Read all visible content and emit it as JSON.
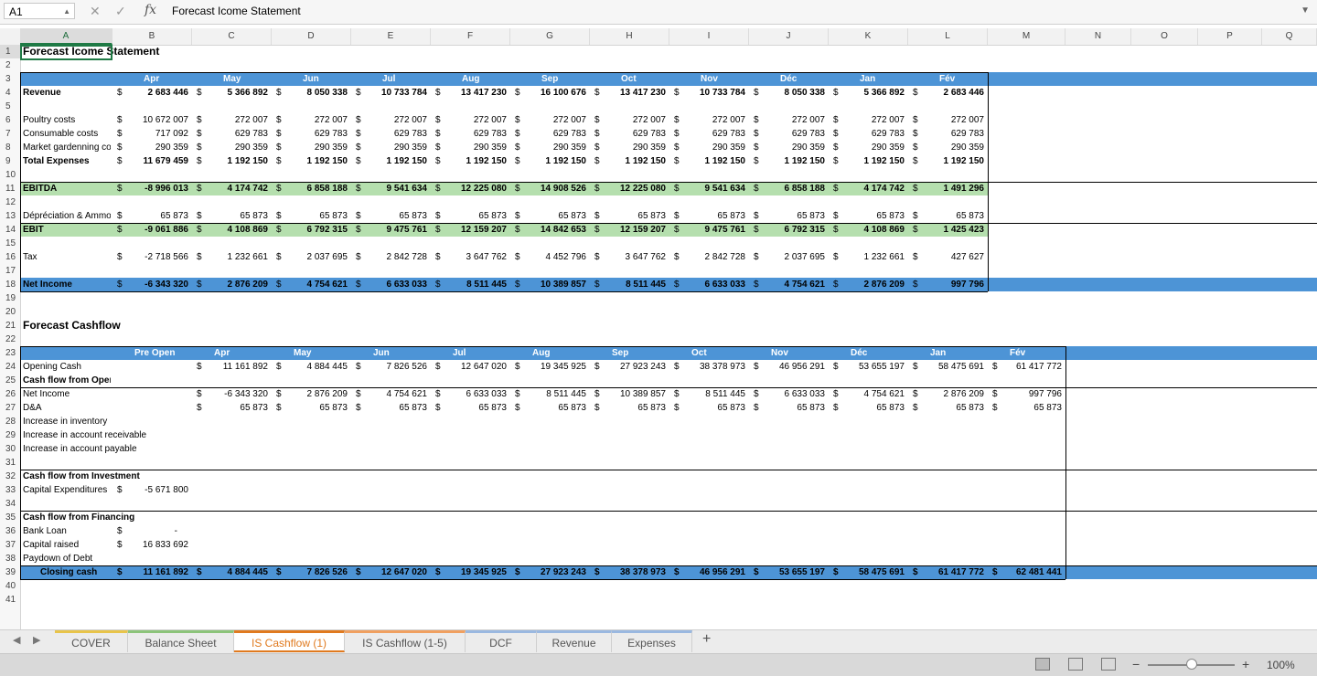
{
  "formula_bar": {
    "cell_ref": "A1",
    "fx": "fx",
    "formula": "Forecast Icome Statement"
  },
  "columns": [
    "A",
    "B",
    "C",
    "D",
    "E",
    "F",
    "G",
    "H",
    "I",
    "J",
    "K",
    "L",
    "M",
    "N",
    "O",
    "P",
    "Q"
  ],
  "rows": [
    "1",
    "2",
    "3",
    "4",
    "5",
    "6",
    "7",
    "8",
    "9",
    "10",
    "11",
    "12",
    "13",
    "14",
    "15",
    "16",
    "17",
    "18",
    "19",
    "20",
    "21",
    "22",
    "23",
    "24",
    "25",
    "26",
    "27",
    "28",
    "29",
    "30",
    "31",
    "32",
    "33",
    "34",
    "35",
    "36",
    "37",
    "38",
    "39",
    "40",
    "41"
  ],
  "income": {
    "title": "Forecast Icome Statement",
    "months": [
      "Apr",
      "May",
      "Jun",
      "Jul",
      "Aug",
      "Sep",
      "Oct",
      "Nov",
      "Déc",
      "Jan",
      "Fév"
    ],
    "rows": [
      {
        "label": "Revenue",
        "bold": true,
        "values": [
          "2 683 446",
          "5 366 892",
          "8 050 338",
          "10 733 784",
          "13 417 230",
          "16 100 676",
          "13 417 230",
          "10 733 784",
          "8 050 338",
          "5 366 892",
          "2 683 446"
        ]
      },
      {
        "label": "Poultry costs",
        "values": [
          "10 672 007",
          "272 007",
          "272 007",
          "272 007",
          "272 007",
          "272 007",
          "272 007",
          "272 007",
          "272 007",
          "272 007",
          "272 007"
        ]
      },
      {
        "label": "Consumable costs",
        "values": [
          "717 092",
          "629 783",
          "629 783",
          "629 783",
          "629 783",
          "629 783",
          "629 783",
          "629 783",
          "629 783",
          "629 783",
          "629 783"
        ]
      },
      {
        "label": "Market gardenning co",
        "values": [
          "290 359",
          "290 359",
          "290 359",
          "290 359",
          "290 359",
          "290 359",
          "290 359",
          "290 359",
          "290 359",
          "290 359",
          "290 359"
        ]
      },
      {
        "label": "Total Expenses",
        "bold": true,
        "values": [
          "11 679 459",
          "1 192 150",
          "1 192 150",
          "1 192 150",
          "1 192 150",
          "1 192 150",
          "1 192 150",
          "1 192 150",
          "1 192 150",
          "1 192 150",
          "1 192 150"
        ]
      },
      {
        "label": "EBITDA",
        "values": [
          "-8 996 013",
          "4 174 742",
          "6 858 188",
          "9 541 634",
          "12 225 080",
          "14 908 526",
          "12 225 080",
          "9 541 634",
          "6 858 188",
          "4 174 742",
          "1 491 296"
        ]
      },
      {
        "label": "Dépréciation & Ammo",
        "values": [
          "65 873",
          "65 873",
          "65 873",
          "65 873",
          "65 873",
          "65 873",
          "65 873",
          "65 873",
          "65 873",
          "65 873",
          "65 873"
        ]
      },
      {
        "label": "EBIT",
        "values": [
          "-9 061 886",
          "4 108 869",
          "6 792 315",
          "9 475 761",
          "12 159 207",
          "14 842 653",
          "12 159 207",
          "9 475 761",
          "6 792 315",
          "4 108 869",
          "1 425 423"
        ]
      },
      {
        "label": "Tax",
        "values": [
          "-2 718 566",
          "1 232 661",
          "2 037 695",
          "2 842 728",
          "3 647 762",
          "4 452 796",
          "3 647 762",
          "2 842 728",
          "2 037 695",
          "1 232 661",
          "427 627"
        ]
      },
      {
        "label": "Net Income",
        "values": [
          "-6 343 320",
          "2 876 209",
          "4 754 621",
          "6 633 033",
          "8 511 445",
          "10 389 857",
          "8 511 445",
          "6 633 033",
          "4 754 621",
          "2 876 209",
          "997 796"
        ]
      }
    ]
  },
  "cashflow": {
    "title": "Forecast Cashflow",
    "months": [
      "Pre Open",
      "Apr",
      "May",
      "Jun",
      "Jul",
      "Aug",
      "Sep",
      "Oct",
      "Nov",
      "Déc",
      "Jan",
      "Fév"
    ],
    "opening": {
      "label": "Opening Cash",
      "values": [
        "11 161 892",
        "4 884 445",
        "7 826 526",
        "12 647 020",
        "19 345 925",
        "27 923 243",
        "38 378 973",
        "46 956 291",
        "53 655 197",
        "58 475 691",
        "61 417 772"
      ]
    },
    "ops_title": "Cash flow from Operations",
    "net_income": {
      "label": "Net Income",
      "values": [
        "-6 343 320",
        "2 876 209",
        "4 754 621",
        "6 633 033",
        "8 511 445",
        "10 389 857",
        "8 511 445",
        "6 633 033",
        "4 754 621",
        "2 876 209",
        "997 796"
      ]
    },
    "da": {
      "label": "D&A",
      "values": [
        "65 873",
        "65 873",
        "65 873",
        "65 873",
        "65 873",
        "65 873",
        "65 873",
        "65 873",
        "65 873",
        "65 873",
        "65 873"
      ]
    },
    "inc_inventory": "Increase in inventory",
    "inc_receivable": "Increase in account receivable",
    "inc_payable": "Increase in account payable",
    "inv_title": "Cash flow from Investment",
    "capex": {
      "label": "Capital Expenditures",
      "value": "-5 671 800"
    },
    "fin_title": "Cash flow from Financing",
    "bank_loan": {
      "label": "Bank Loan",
      "value": "-"
    },
    "capital_raised": {
      "label": "Capital raised",
      "value": "16 833 692"
    },
    "paydown": "Paydown of Debt",
    "closing": {
      "label": "Closing cash",
      "values": [
        "11 161 892",
        "4 884 445",
        "7 826 526",
        "12 647 020",
        "19 345 925",
        "27 923 243",
        "38 378 973",
        "46 956 291",
        "53 655 197",
        "58 475 691",
        "61 417 772",
        "62 481 441"
      ]
    }
  },
  "currency": "$",
  "sheet_tabs": [
    {
      "label": "COVER",
      "color": "#e8c44a"
    },
    {
      "label": "Balance Sheet",
      "color": "#8cc47a"
    },
    {
      "label": "IS Cashflow (1)",
      "color": "#e07a1f",
      "active": true
    },
    {
      "label": "IS Cashflow (1-5)",
      "color": "#f0a060"
    },
    {
      "label": "DCF",
      "color": "#9ab8e0"
    },
    {
      "label": "Revenue",
      "color": "#9ab8e0"
    },
    {
      "label": "Expenses",
      "color": "#9ab8e0"
    }
  ],
  "add_sheet": "+",
  "zoom": "100%"
}
